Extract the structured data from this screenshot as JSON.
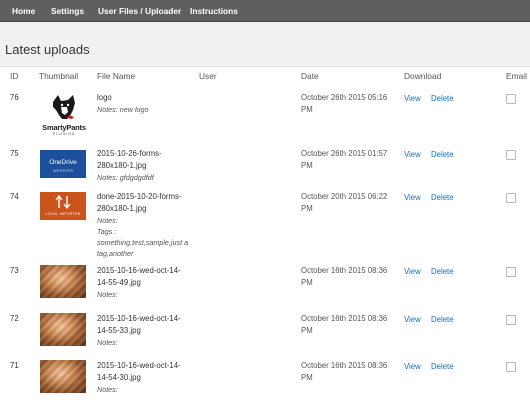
{
  "nav": {
    "items": [
      {
        "label": "Home"
      },
      {
        "label": "Settings"
      },
      {
        "label": "User Files / Uploader"
      },
      {
        "label": "Instructions"
      }
    ]
  },
  "page": {
    "title": "Latest uploads"
  },
  "table": {
    "columns": {
      "id": "ID",
      "thumbnail": "Thumbnail",
      "file_name": "File Name",
      "user": "User",
      "date": "Date",
      "download": "Download",
      "email": "Email"
    },
    "rows": [
      {
        "id": "76",
        "name": "logo",
        "notes": "Notes: new logo",
        "user": "",
        "date": "October 26th 2015 05:16 PM",
        "view": "View",
        "delete": "Delete",
        "thumb": "smartypants-logo",
        "thumb_text": "SmartyPants",
        "thumb_sub": "PLUGINS"
      },
      {
        "id": "75",
        "name": "2015-10-26-forms-280x180-1.jpg",
        "notes": "Notes: gfdgdgdfdf",
        "user": "",
        "date": "October 26th 2015 01:57 PM",
        "view": "View",
        "delete": "Delete",
        "thumb": "onedrive-importer",
        "thumb_text": "OneDrive",
        "thumb_sub": "IMPORTER"
      },
      {
        "id": "74",
        "name": "done-2015-10-20-forms-280x180-1.jpg",
        "notes": "Notes:",
        "tags": "Tags : something,test,sample,just a tag,another",
        "user": "",
        "date": "October 20th 2015 06:22 PM",
        "view": "View",
        "delete": "Delete",
        "thumb": "local-importer",
        "thumb_text": "LOCAL IMPORTER"
      },
      {
        "id": "73",
        "name": "2015-10-16-wed-oct-14-14-55-49.jpg",
        "notes": "Notes:",
        "user": "",
        "date": "October 16th 2015 08:36 PM",
        "view": "View",
        "delete": "Delete",
        "thumb": "photo"
      },
      {
        "id": "72",
        "name": "2015-10-16-wed-oct-14-14-55-33.jpg",
        "notes": "Notes:",
        "user": "",
        "date": "October 16th 2015 08:36 PM",
        "view": "View",
        "delete": "Delete",
        "thumb": "photo"
      },
      {
        "id": "71",
        "name": "2015-10-16-wed-oct-14-14-54-30.jpg",
        "notes": "Notes:",
        "user": "",
        "date": "October 16th 2015 08:36 PM",
        "view": "View",
        "delete": "Delete",
        "thumb": "photo"
      }
    ]
  },
  "colors": {
    "nav_bg": "#5f5f5f",
    "page_bg": "#f1f1f1",
    "link": "#1b6fb3",
    "onedrive_blue": "#1e4f9c",
    "importer_orange": "#c9541c"
  }
}
